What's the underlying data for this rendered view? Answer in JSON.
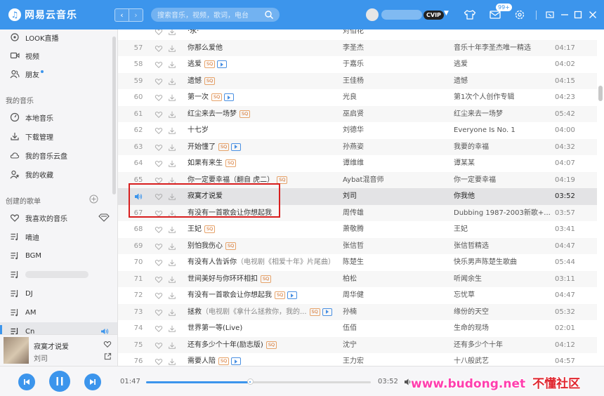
{
  "app": {
    "name": "网易云音乐",
    "accent": "#3c95ec"
  },
  "header": {
    "search_placeholder": "搜索音乐，视频，歌词，电台",
    "vip_label": "CVIP",
    "message_badge": "99+"
  },
  "sidebar": {
    "top_items": [
      {
        "label": "LOOK直播",
        "icon": "live-icon"
      },
      {
        "label": "视频",
        "icon": "video-icon"
      },
      {
        "label": "朋友",
        "icon": "friends-icon"
      }
    ],
    "my_music_title": "我的音乐",
    "my_music_items": [
      {
        "label": "本地音乐",
        "icon": "local-music-icon"
      },
      {
        "label": "下载管理",
        "icon": "download-icon"
      },
      {
        "label": "我的音乐云盘",
        "icon": "cloud-icon"
      },
      {
        "label": "我的收藏",
        "icon": "collection-icon"
      }
    ],
    "playlists_title": "创建的歌单",
    "playlists": [
      {
        "label": "我喜欢的音乐",
        "icon": "heart-icon"
      },
      {
        "label": "嘀迪",
        "icon": "playlist-icon"
      },
      {
        "label": "BGM",
        "icon": "playlist-icon"
      },
      {
        "label": "",
        "icon": "playlist-icon"
      },
      {
        "label": "DJ",
        "icon": "playlist-icon"
      },
      {
        "label": "AM",
        "icon": "playlist-icon"
      },
      {
        "label": "Cn",
        "icon": "playlist-icon"
      }
    ]
  },
  "now_playing": {
    "title": "寂寞才说爱",
    "artist": "刘司"
  },
  "player": {
    "current_time": "01:47",
    "total_time": "03:52",
    "progress": 0.4612
  },
  "songs": [
    {
      "idx": "",
      "title": "·永·",
      "sub": "",
      "sq": false,
      "mv": false,
      "artist": "对佰花",
      "album": "",
      "dur": ""
    },
    {
      "idx": "57",
      "title": "你那么爱他",
      "sub": "",
      "sq": false,
      "mv": false,
      "artist": "李圣杰",
      "album": "音乐十年李圣杰唯一精选",
      "dur": "04:17"
    },
    {
      "idx": "58",
      "title": "逃爱",
      "sub": "",
      "sq": true,
      "mv": true,
      "artist": "于嘉乐",
      "album": "逃爱",
      "dur": "04:02"
    },
    {
      "idx": "59",
      "title": "遗憾",
      "sub": "",
      "sq": true,
      "mv": false,
      "artist": "王佳杨",
      "album": "遗憾",
      "dur": "04:15"
    },
    {
      "idx": "60",
      "title": "第一次",
      "sub": "",
      "sq": true,
      "mv": true,
      "artist": "光良",
      "album": "第1次个人创作专辑",
      "dur": "04:23"
    },
    {
      "idx": "61",
      "title": "红尘来去一场梦",
      "sub": "",
      "sq": true,
      "mv": false,
      "artist": "巫启贤",
      "album": "红尘来去一场梦",
      "dur": "05:42"
    },
    {
      "idx": "62",
      "title": "十七岁",
      "sub": "",
      "sq": false,
      "mv": false,
      "artist": "刘德华",
      "album": "Everyone Is No. 1",
      "dur": "04:00"
    },
    {
      "idx": "63",
      "title": "开始懂了",
      "sub": "",
      "sq": true,
      "mv": true,
      "artist": "孙燕姿",
      "album": "我要的幸福",
      "dur": "04:32"
    },
    {
      "idx": "64",
      "title": "如果有来生",
      "sub": "",
      "sq": true,
      "mv": false,
      "artist": "谭维维",
      "album": "谭某某",
      "dur": "04:07"
    },
    {
      "idx": "65",
      "title": "你一定要幸福（翻自 虎二）",
      "sub": "",
      "sq": true,
      "mv": false,
      "artist": "Aybat混音师",
      "album": "你一定要幸福",
      "dur": "04:19"
    },
    {
      "idx": "",
      "title": "寂寞才说爱",
      "sub": "",
      "sq": false,
      "mv": false,
      "artist": "刘司",
      "album": "你我他",
      "dur": "03:52",
      "playing": true
    },
    {
      "idx": "67",
      "title": "有没有一首歌会让你想起我",
      "sub": "",
      "sq": false,
      "mv": false,
      "artist": "周传雄",
      "album": "Dubbing 1987-2003新歌+...",
      "dur": "03:57"
    },
    {
      "idx": "68",
      "title": "王妃",
      "sub": "",
      "sq": true,
      "mv": false,
      "artist": "萧敬腾",
      "album": "王妃",
      "dur": "03:41"
    },
    {
      "idx": "69",
      "title": "别怕我伤心",
      "sub": "",
      "sq": true,
      "mv": false,
      "artist": "张信哲",
      "album": "张信哲精选",
      "dur": "04:47"
    },
    {
      "idx": "70",
      "title": "有没有人告诉你",
      "sub": "（电视剧《相爱十年》片尾曲）",
      "sq": false,
      "mv": false,
      "artist": "陈楚生",
      "album": "快乐男声陈楚生歌曲",
      "dur": "05:44"
    },
    {
      "idx": "71",
      "title": "世间美好与你环环相扣",
      "sub": "",
      "sq": true,
      "mv": false,
      "artist": "柏松",
      "album": "听闻余生",
      "dur": "03:11"
    },
    {
      "idx": "72",
      "title": "有没有一首歌会让你想起我",
      "sub": "",
      "sq": true,
      "mv": true,
      "artist": "周华健",
      "album": "忘忧草",
      "dur": "04:47"
    },
    {
      "idx": "73",
      "title": "拯救",
      "sub": "（电视剧《拿什么拯救你，我的...",
      "sq": true,
      "mv": true,
      "artist": "孙楠",
      "album": "缘份的天空",
      "dur": "05:32"
    },
    {
      "idx": "74",
      "title": "世界第一等(Live)",
      "sub": "",
      "sq": false,
      "mv": false,
      "artist": "伍佰",
      "album": "生命的现场",
      "dur": "02:01"
    },
    {
      "idx": "75",
      "title": "还有多少个十年(励志版)",
      "sub": "",
      "sq": true,
      "mv": false,
      "artist": "沈宁",
      "album": "还有多少个十年",
      "dur": "04:12"
    },
    {
      "idx": "76",
      "title": "需要人陪",
      "sub": "",
      "sq": true,
      "mv": true,
      "artist": "王力宏",
      "album": "十八般武艺",
      "dur": "04:57"
    }
  ],
  "watermark": {
    "latin": "www.budong.net",
    "cn": "不懂社区"
  }
}
